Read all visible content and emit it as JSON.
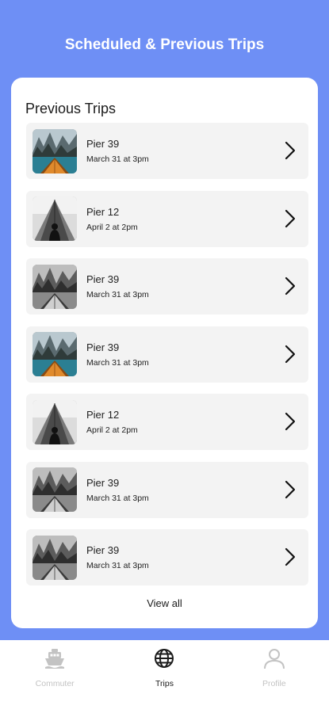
{
  "header": {
    "title": "Scheduled & Previous Trips"
  },
  "card": {
    "title": "Previous Trips",
    "view_all_label": "View all"
  },
  "trips": [
    {
      "name": "Pier 39",
      "date": "March 31 at 3pm",
      "thumb": "lake-boat-color"
    },
    {
      "name": "Pier 12",
      "date": "April 2 at 2pm",
      "thumb": "boat-person-bw"
    },
    {
      "name": "Pier 39",
      "date": "March 31 at 3pm",
      "thumb": "lake-boat-bw"
    },
    {
      "name": "Pier 39",
      "date": "March 31 at 3pm",
      "thumb": "lake-boat-color"
    },
    {
      "name": "Pier 12",
      "date": "April 2 at 2pm",
      "thumb": "boat-person-bw"
    },
    {
      "name": "Pier 39",
      "date": "March 31 at 3pm",
      "thumb": "lake-boat-bw"
    },
    {
      "name": "Pier 39",
      "date": "March 31 at 3pm",
      "thumb": "lake-boat-bw"
    }
  ],
  "tabs": [
    {
      "label": "Commuter",
      "icon": "ferry-icon",
      "active": false
    },
    {
      "label": "Trips",
      "icon": "globe-icon",
      "active": true
    },
    {
      "label": "Profile",
      "icon": "user-icon",
      "active": false
    }
  ],
  "colors": {
    "header_bg": "#6e8ff5",
    "card_bg": "#ffffff",
    "row_bg": "#f3f3f3",
    "inactive_tab": "#c3c3c3"
  }
}
